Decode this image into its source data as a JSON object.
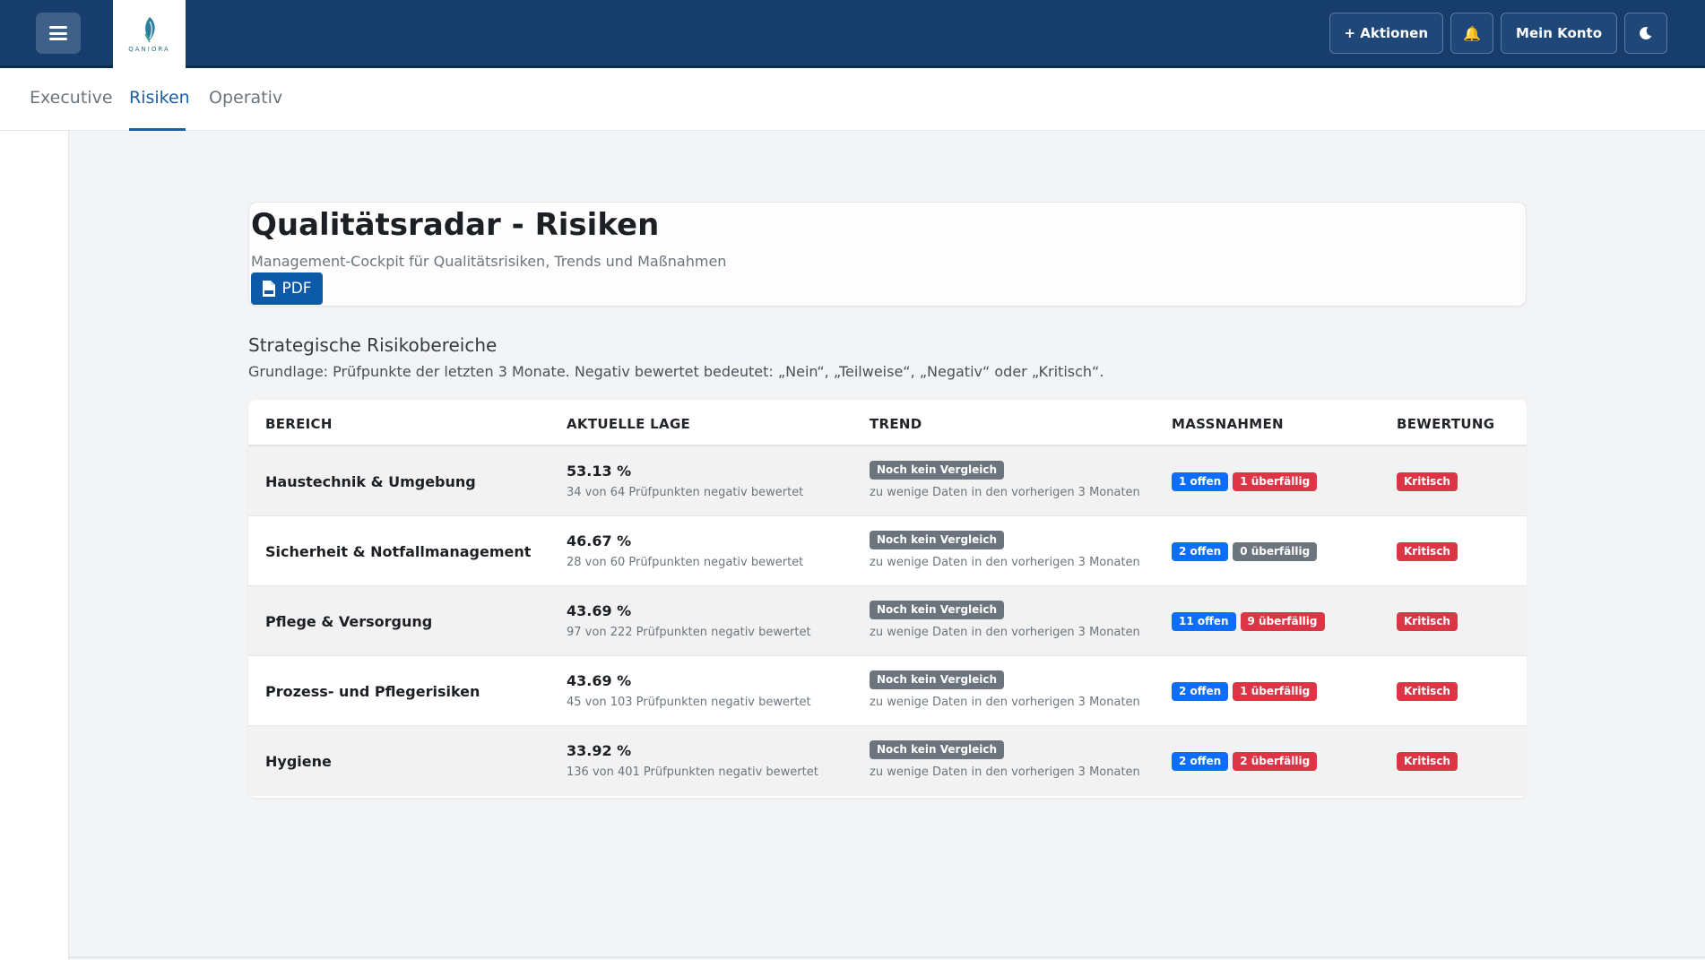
{
  "app": {
    "logo_text": "QANIORA",
    "nav": {
      "actions_label": "+ Aktionen",
      "account_label": "Mein Konto"
    }
  },
  "tabs": [
    {
      "label": "Executive"
    },
    {
      "label": "Risiken"
    },
    {
      "label": "Operativ"
    }
  ],
  "header": {
    "title": "Qualitätsradar - Risiken",
    "subtitle": "Management-Cockpit für Qualitätsrisiken, Trends und Maßnahmen",
    "pdf_label": "PDF"
  },
  "section": {
    "title": "Strategische Risikobereiche",
    "note": "Grundlage: Prüfpunkte der letzten 3 Monate. Negativ bewertet bedeutet: „Nein“, „Teilweise“, „Negativ“ oder „Kritisch“."
  },
  "table": {
    "headers": [
      "BEREICH",
      "AKTUELLE LAGE",
      "TREND",
      "MASSNAHMEN",
      "BEWERTUNG"
    ],
    "rows": [
      {
        "area": "Haustechnik & Umgebung",
        "percent": "53.13 %",
        "detail": "34 von 64 Prüfpunkten negativ bewertet",
        "trend": "Noch kein Vergleich",
        "trend_detail": "zu wenige Daten in den vorherigen 3 Monaten",
        "open": "1 offen",
        "overdue": "1 überfällig",
        "rating": "Kritisch"
      },
      {
        "area": "Sicherheit & Notfallmanagement",
        "percent": "46.67 %",
        "detail": "28 von 60 Prüfpunkten negativ bewertet",
        "trend": "Noch kein Vergleich",
        "trend_detail": "zu wenige Daten in den vorherigen 3 Monaten",
        "open": "2 offen",
        "overdue": "0 überfällig",
        "rating": "Kritisch"
      },
      {
        "area": "Pflege & Versorgung",
        "percent": "43.69 %",
        "detail": "97 von 222 Prüfpunkten negativ bewertet",
        "trend": "Noch kein Vergleich",
        "trend_detail": "zu wenige Daten in den vorherigen 3 Monaten",
        "open": "11 offen",
        "overdue": "9 überfällig",
        "rating": "Kritisch"
      },
      {
        "area": "Prozess- und Pflegerisiken",
        "percent": "43.69 %",
        "detail": "45 von 103 Prüfpunkten negativ bewertet",
        "trend": "Noch kein Vergleich",
        "trend_detail": "zu wenige Daten in den vorherigen 3 Monaten",
        "open": "2 offen",
        "overdue": "1 überfällig",
        "rating": "Kritisch"
      },
      {
        "area": "Hygiene",
        "percent": "33.92 %",
        "detail": "136 von 401 Prüfpunkten negativ bewertet",
        "trend": "Noch kein Vergleich",
        "trend_detail": "zu wenige Daten in den vorherigen 3 Monaten",
        "open": "2 offen",
        "overdue": "2 überfällig",
        "rating": "Kritisch"
      }
    ]
  },
  "colors": {
    "navbar": "#173d6c",
    "accent": "#1a5fa8",
    "badge_blue": "#0d6efd",
    "badge_red": "#dc3545",
    "badge_gray": "#6c757d"
  }
}
